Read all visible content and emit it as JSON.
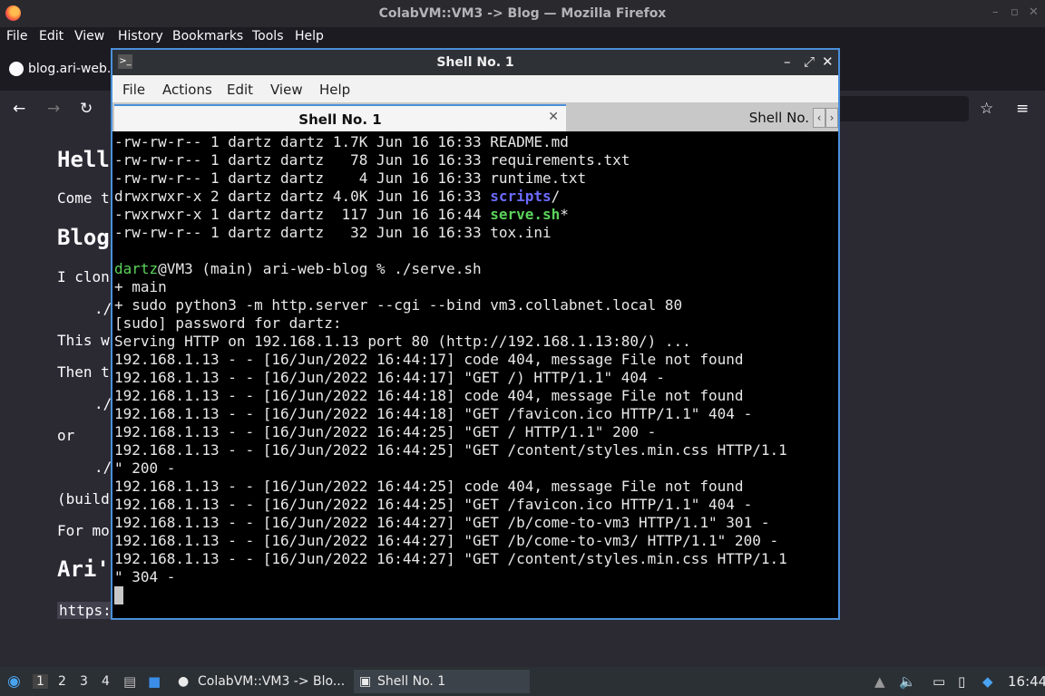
{
  "firefox": {
    "title": "ColabVM::VM3 -> Blog — Mozilla Firefox",
    "menu": [
      "File",
      "Edit",
      "View",
      "History",
      "Bookmarks",
      "Tools",
      "Help"
    ],
    "tab_label": "blog.ari-web.x",
    "content": {
      "h1": "Hell",
      "p1": "Come t",
      "h2": "Blog",
      "p2": "I clon",
      "code1": "./",
      "p3": "This w",
      "p4": "Then t",
      "code2": "./",
      "p5": "or",
      "code3": "./",
      "p6": "(build",
      "p7": "For mo",
      "h3": "Ari'",
      "link": "https:"
    }
  },
  "terminal": {
    "title": "Shell No. 1",
    "menu": [
      "File",
      "Actions",
      "Edit",
      "View",
      "Help"
    ],
    "tabs": [
      "Shell No. 1",
      "Shell No."
    ],
    "listing": [
      {
        "meta": "-rw-rw-r-- 1 dartz dartz 1.7K Jun 16 16:33 ",
        "name": "README.md",
        "kind": "file",
        "suffix": ""
      },
      {
        "meta": "-rw-rw-r-- 1 dartz dartz   78 Jun 16 16:33 ",
        "name": "requirements.txt",
        "kind": "file",
        "suffix": ""
      },
      {
        "meta": "-rw-rw-r-- 1 dartz dartz    4 Jun 16 16:33 ",
        "name": "runtime.txt",
        "kind": "file",
        "suffix": ""
      },
      {
        "meta": "drwxrwxr-x 2 dartz dartz 4.0K Jun 16 16:33 ",
        "name": "scripts",
        "kind": "dir",
        "suffix": "/"
      },
      {
        "meta": "-rwxrwxr-x 1 dartz dartz  117 Jun 16 16:44 ",
        "name": "serve.sh",
        "kind": "exe",
        "suffix": "*"
      },
      {
        "meta": "-rw-rw-r-- 1 dartz dartz   32 Jun 16 16:33 ",
        "name": "tox.ini",
        "kind": "file",
        "suffix": ""
      }
    ],
    "prompt_user": "dartz",
    "prompt_rest": "@VM3 (main) ari-web-blog % ./serve.sh",
    "output": [
      "+ main",
      "+ sudo python3 -m http.server --cgi --bind vm3.collabnet.local 80",
      "[sudo] password for dartz:",
      "Serving HTTP on 192.168.1.13 port 80 (http://192.168.1.13:80/) ...",
      "192.168.1.13 - - [16/Jun/2022 16:44:17] code 404, message File not found",
      "192.168.1.13 - - [16/Jun/2022 16:44:17] \"GET /) HTTP/1.1\" 404 -",
      "192.168.1.13 - - [16/Jun/2022 16:44:18] code 404, message File not found",
      "192.168.1.13 - - [16/Jun/2022 16:44:18] \"GET /favicon.ico HTTP/1.1\" 404 -",
      "192.168.1.13 - - [16/Jun/2022 16:44:25] \"GET / HTTP/1.1\" 200 -",
      "192.168.1.13 - - [16/Jun/2022 16:44:25] \"GET /content/styles.min.css HTTP/1.1",
      "\" 200 -",
      "192.168.1.13 - - [16/Jun/2022 16:44:25] code 404, message File not found",
      "192.168.1.13 - - [16/Jun/2022 16:44:25] \"GET /favicon.ico HTTP/1.1\" 404 -",
      "192.168.1.13 - - [16/Jun/2022 16:44:27] \"GET /b/come-to-vm3 HTTP/1.1\" 301 -",
      "192.168.1.13 - - [16/Jun/2022 16:44:27] \"GET /b/come-to-vm3/ HTTP/1.1\" 200 -",
      "192.168.1.13 - - [16/Jun/2022 16:44:27] \"GET /content/styles.min.css HTTP/1.1",
      "\" 304 -"
    ]
  },
  "taskbar": {
    "workspaces": [
      "1",
      "2",
      "3",
      "4"
    ],
    "tasks": [
      "ColabVM::VM3 -> Blo...",
      "Shell No. 1"
    ],
    "clock": "16:44"
  }
}
